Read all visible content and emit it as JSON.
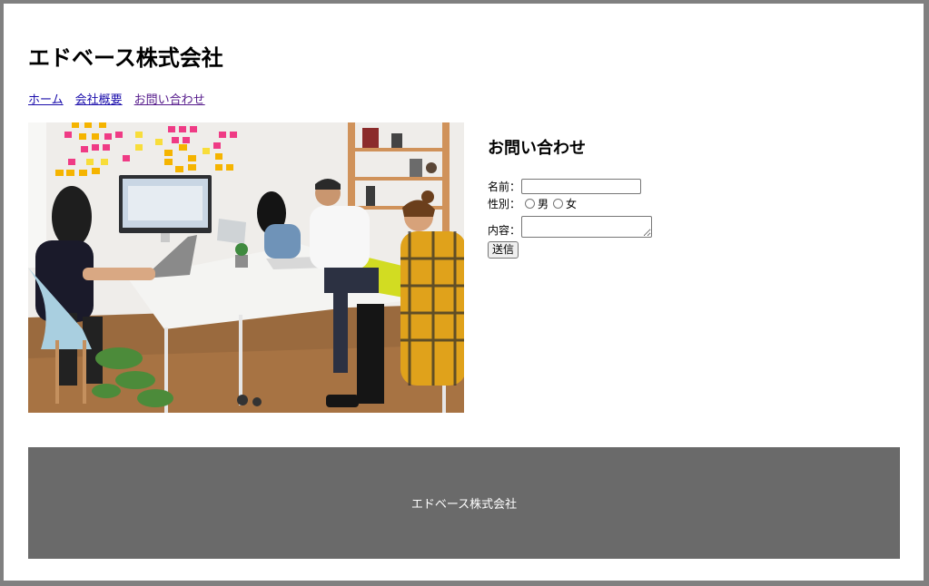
{
  "header": {
    "title": "エドベース株式会社"
  },
  "nav": {
    "items": [
      {
        "label": "ホーム"
      },
      {
        "label": "会社概要"
      },
      {
        "label": "お問い合わせ"
      }
    ]
  },
  "hero_image": {
    "description_icon": "meeting-photo"
  },
  "contact": {
    "heading": "お問い合わせ",
    "name_label": "名前：",
    "name_value": "",
    "gender_label": "性別：",
    "gender_options": [
      "男",
      "女"
    ],
    "content_label": "内容：",
    "content_value": "",
    "submit_label": "送信"
  },
  "footer": {
    "text": "エドベース株式会社"
  },
  "colors": {
    "frame": "#808080",
    "footer_bg": "#6a6a6a",
    "link": "#1a0dab",
    "link_visited": "#551a8b"
  }
}
